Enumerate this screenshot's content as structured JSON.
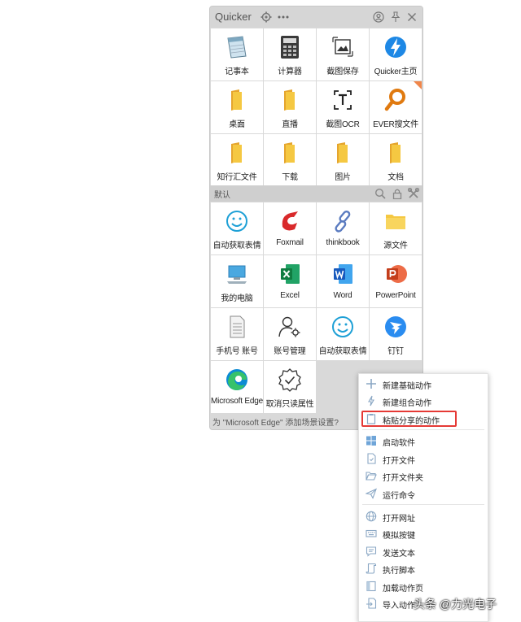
{
  "window": {
    "app_name": "Quicker"
  },
  "top_grid": [
    {
      "label": "记事本",
      "icon": "notepad-icon"
    },
    {
      "label": "计算器",
      "icon": "calculator-icon"
    },
    {
      "label": "截图保存",
      "icon": "screenshot-save-icon"
    },
    {
      "label": "Quicker主页",
      "icon": "quicker-bolt-icon"
    },
    {
      "label": "桌面",
      "icon": "folder-icon"
    },
    {
      "label": "直播",
      "icon": "folder-icon"
    },
    {
      "label": "截图OCR",
      "icon": "ocr-icon"
    },
    {
      "label": "EVER搜文件",
      "icon": "search-file-icon"
    },
    {
      "label": "知行汇文件",
      "icon": "folder-icon"
    },
    {
      "label": "下载",
      "icon": "folder-icon"
    },
    {
      "label": "图片",
      "icon": "folder-icon"
    },
    {
      "label": "文档",
      "icon": "folder-icon"
    }
  ],
  "section": {
    "name": "默认"
  },
  "bottom_grid": [
    {
      "label": "自动获取表情",
      "icon": "smiley-icon"
    },
    {
      "label": "Foxmail",
      "icon": "foxmail-icon"
    },
    {
      "label": "thinkbook",
      "icon": "chain-link-icon"
    },
    {
      "label": "源文件",
      "icon": "folder-icon"
    },
    {
      "label": "我的电脑",
      "icon": "computer-icon"
    },
    {
      "label": "Excel",
      "icon": "excel-icon"
    },
    {
      "label": "Word",
      "icon": "word-icon"
    },
    {
      "label": "PowerPoint",
      "icon": "powerpoint-icon"
    },
    {
      "label": "手机号 账号",
      "icon": "document-icon"
    },
    {
      "label": "账号管理",
      "icon": "user-settings-icon"
    },
    {
      "label": "自动获取表情",
      "icon": "smiley-icon"
    },
    {
      "label": "钉钉",
      "icon": "dingtalk-icon"
    },
    {
      "label": "Microsoft Edge",
      "icon": "edge-icon"
    },
    {
      "label": "取消只读属性",
      "icon": "badge-check-icon"
    }
  ],
  "status_text": "为 \"Microsoft Edge\" 添加场景设置?",
  "context_menu": {
    "groups": [
      [
        {
          "label": "新建基础动作",
          "icon": "plus-icon"
        },
        {
          "label": "新建组合动作",
          "icon": "lightning-icon"
        },
        {
          "label": "粘贴分享的动作",
          "icon": "clipboard-icon"
        }
      ],
      [
        {
          "label": "启动软件",
          "icon": "windows-icon"
        },
        {
          "label": "打开文件",
          "icon": "file-icon"
        },
        {
          "label": "打开文件夹",
          "icon": "folder-open-icon"
        },
        {
          "label": "运行命令",
          "icon": "send-icon"
        }
      ],
      [
        {
          "label": "打开网址",
          "icon": "globe-icon"
        },
        {
          "label": "模拟按键",
          "icon": "keyboard-icon"
        },
        {
          "label": "发送文本",
          "icon": "message-icon"
        },
        {
          "label": "执行脚本",
          "icon": "script-icon"
        },
        {
          "label": "加载动作页",
          "icon": "page-icon"
        },
        {
          "label": "导入动作",
          "icon": "import-icon"
        }
      ]
    ]
  },
  "watermark": "头条 @力光电子",
  "colors": {
    "highlight": "#e53935",
    "folder": "#f5c842",
    "accent": "#1e88e5"
  }
}
